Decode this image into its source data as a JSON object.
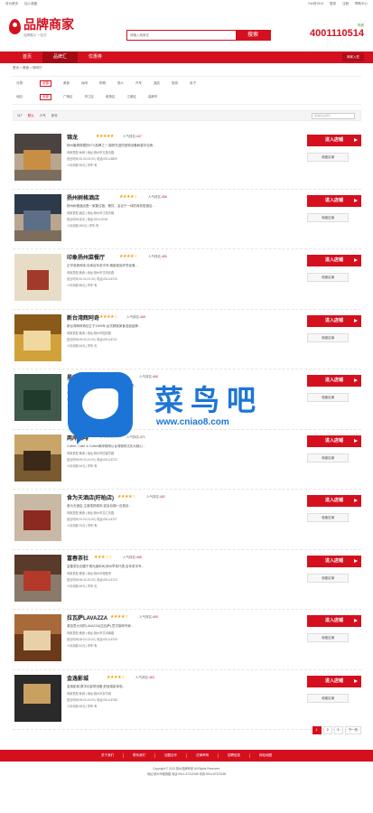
{
  "topbar": {
    "left1": "设为首页",
    "left2": "加入收藏",
    "user": "Yue钱1514",
    "login": "登录",
    "register": "注册",
    "help": "帮助中心"
  },
  "header": {
    "brand": "品牌商家",
    "slogan": "品牌展示 一站式",
    "search_placeholder": "请输入商家名",
    "search_btn": "搜索",
    "hotline_tag": "热线",
    "hotline": "4001110514"
  },
  "nav": {
    "items": [
      "首页",
      "品牌汇",
      "优惠券"
    ],
    "enter": "商家入驻"
  },
  "breadcrumb": "首页 > 美食 > 咖啡厅",
  "filters": {
    "cat_label": "分类:",
    "cats": [
      "全部",
      "美食",
      "休闲",
      "购物",
      "丽人",
      "汽车",
      "酒店",
      "旅游",
      "亲子"
    ],
    "area_label": "地区:",
    "areas": [
      "全部",
      "广陵区",
      "邗江区",
      "维扬区",
      "江都区",
      "高邮市"
    ]
  },
  "sort": {
    "count": "117",
    "items": [
      "默认",
      "人气",
      "评分"
    ],
    "keyword_placeholder": "店铺名关键字"
  },
  "buttons": {
    "enter": "进入店铺",
    "collect": "收藏店铺"
  },
  "shops": [
    {
      "name": "锦龙",
      "rank": "人气排名:",
      "rank_val": "447",
      "desc": "杨州最具规模的KTV品牌之一,拥有先进的音响设备和豪华包房...",
      "m1": "商家类型:休闲 | 地址:扬州市文昌中路",
      "m2": "营业时间:10:00-02:00 | 电话:0514-8899",
      "m3": "人均消费:95元 | 停车:有"
    },
    {
      "name": "扬州树格酒店",
      "rank": "人气排名:",
      "rank_val": "456",
      "desc": "扬州树格酒店是一家集住宿、餐饮、会议于一体的商务型酒店...",
      "m1": "商家类型:酒店 | 地址:扬州市江阳中路",
      "m2": "营业时间:全天 | 电话:0514-8766",
      "m3": "人均消费:280元 | 停车:有"
    },
    {
      "name": "印象扬州菜餐厅",
      "rank": "人气排名:",
      "rank_val": "459",
      "desc": "正宗淮扬风味,传承百年老字号,精致菜品环境优雅...",
      "m1": "商家类型:美食 | 地址:扬州市汶河北路",
      "m2": "营业时间:10:00-21:30 | 电话:0514-8733",
      "m3": "人均消费:88元 | 停车:有"
    },
    {
      "name": "新台湾辉阿奇",
      "rank": "人气排名:",
      "rank_val": "459",
      "desc": "新台湾辉阿奇创立于1999年,台式精致美食连锁品牌...",
      "m1": "商家类型:美食 | 地址:扬州市国庆路",
      "m2": "营业时间:09:00-22:00 | 电话:0514-8721",
      "m3": "人均消费:45元 | 停车:无"
    },
    {
      "name": "星巴克咖啡",
      "rank": "人气排名:",
      "rank_val": "466",
      "desc": "全球著名咖啡连锁品牌,提供优质咖啡和舒适环境...",
      "m1": "商家类型:美食 | 地址:扬州市文昌西路",
      "m2": "营业时间:07:00-22:00 | 电话:0514-8711",
      "m3": "人均消费:38元 | 停车:有"
    },
    {
      "name": "两岸咖啡",
      "rank": "人气排名:",
      "rank_val": "471",
      "desc": "Coffee, Cake & Coffee两岸咖啡以台湾咖啡文化为核心...",
      "m1": "商家类型:美食 | 地址:扬州市四望亭路",
      "m2": "营业时间:09:00-24:00 | 电话:0514-8722",
      "m3": "人均消费:60元 | 停车:有"
    },
    {
      "name": "食为天酒店(盱眙店)",
      "rank": "人气排名:",
      "rank_val": "452",
      "desc": "食为天酒店,主营淮扬菜系,宴会包厢一应俱全...",
      "m1": "商家类型:美食 | 地址:扬州市文汇东路",
      "m2": "营业时间:10:00-21:00 | 电话:0514-8707",
      "m3": "人均消费:75元 | 停车:有"
    },
    {
      "name": "富春茶社",
      "rank": "人气排名:",
      "rank_val": "458",
      "desc": "富春茶社创建于清光绪年间,扬州早茶代表,百年老字号...",
      "m1": "商家类型:美食 | 地址:扬州市得胜桥",
      "m2": "营业时间:06:30-20:30 | 电话:0514-8723",
      "m3": "人均消费:50元 | 停车:无"
    },
    {
      "name": "拉瓦萨LAVAZZA",
      "rank": "人气排名:",
      "rank_val": "460",
      "desc": "源自意大利的LAVAZZA(拉瓦萨),意式咖啡专家...",
      "m1": "商家类型:美食 | 地址:扬州市汶河南路",
      "m2": "营业时间:08:00-22:00 | 电话:0514-8709",
      "m3": "人均消费:42元 | 停车:有"
    },
    {
      "name": "金逸影城",
      "rank": "人气排名:",
      "rank_val": "463",
      "desc": "金逸影城,数字化影院设备,舒适观影体验...",
      "m1": "商家类型:休闲 | 地址:扬州市京华城",
      "m2": "营业时间:09:00-24:00 | 电话:0514-8788",
      "m3": "人均消费:50元 | 停车:有"
    }
  ],
  "pager": {
    "pages": [
      "1",
      "2",
      "3"
    ],
    "next": "下一页"
  },
  "footer": {
    "links": [
      "关于我们",
      "联系我们",
      "加盟合作",
      "法律声明",
      "招聘信息",
      "网站地图"
    ],
    "copy1": "Copyright © 2013 扬州品牌商家 All Rights Reserved.",
    "copy2": "地址:扬州市维扬路 电话:0514-87222188 传真:0514-87222188"
  },
  "watermark": {
    "text": "菜鸟吧",
    "url": "www.cniao8.com"
  }
}
